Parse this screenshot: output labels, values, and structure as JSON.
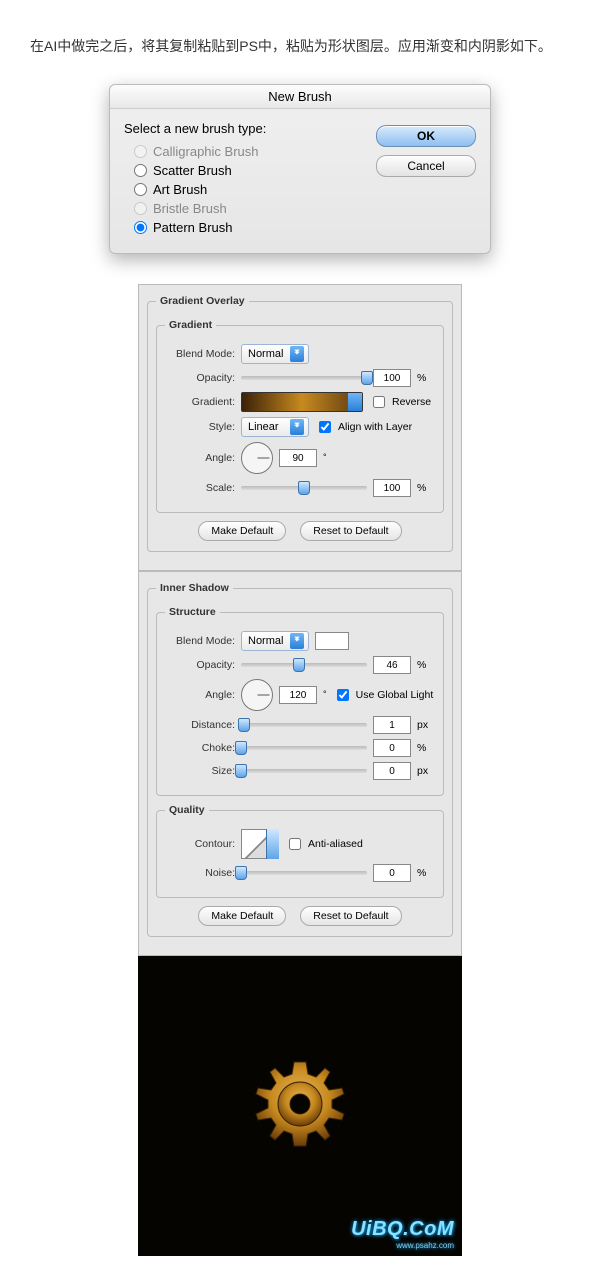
{
  "intro": "在AI中做完之后，将其复制粘贴到PS中，粘贴为形状图层。应用渐变和内阴影如下。",
  "newBrush": {
    "title": "New Brush",
    "prompt": "Select a new brush type:",
    "options": [
      "Calligraphic Brush",
      "Scatter Brush",
      "Art Brush",
      "Bristle Brush",
      "Pattern Brush"
    ],
    "selectedIndex": 4,
    "ok": "OK",
    "cancel": "Cancel"
  },
  "gradientOverlay": {
    "legend": "Gradient Overlay",
    "sub": "Gradient",
    "blendLabel": "Blend Mode:",
    "blendValue": "Normal",
    "opacityLabel": "Opacity:",
    "opacityValue": "100",
    "pct": "%",
    "gradientLabel": "Gradient:",
    "reverseLabel": "Reverse",
    "styleLabel": "Style:",
    "styleValue": "Linear",
    "alignLabel": "Align with Layer",
    "angleLabel": "Angle:",
    "angleValue": "90",
    "scaleLabel": "Scale:",
    "scaleValue": "100",
    "makeDefault": "Make Default",
    "resetDefault": "Reset to Default"
  },
  "innerShadow": {
    "legend": "Inner Shadow",
    "structure": "Structure",
    "blendLabel": "Blend Mode:",
    "blendValue": "Normal",
    "opacityLabel": "Opacity:",
    "opacityValue": "46",
    "pct": "%",
    "angleLabel": "Angle:",
    "angleValue": "120",
    "globalLabel": "Use Global Light",
    "distanceLabel": "Distance:",
    "distanceValue": "1",
    "px": "px",
    "chokeLabel": "Choke:",
    "chokeValue": "0",
    "sizeLabel": "Size:",
    "sizeValue": "0",
    "quality": "Quality",
    "contourLabel": "Contour:",
    "antiLabel": "Anti-aliased",
    "noiseLabel": "Noise:",
    "noiseValue": "0",
    "makeDefault": "Make Default",
    "resetDefault": "Reset to Default"
  },
  "watermark": {
    "main": "UiBQ.CoM",
    "sub": "www.psahz.com"
  }
}
